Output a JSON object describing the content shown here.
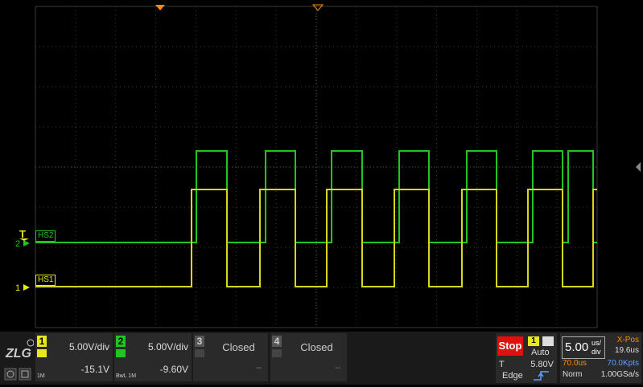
{
  "waveform": {
    "channel_markers": [
      "2",
      "1"
    ],
    "trigger_marker": "T",
    "labels": [
      "HS2",
      "HS1"
    ]
  },
  "channels": [
    {
      "number": "1",
      "scale": "5.00V/div",
      "offset": "-15.1V",
      "impedance": "1M",
      "color": "#e8e81e"
    },
    {
      "number": "2",
      "scale": "5.00V/div",
      "offset": "-9.60V",
      "impedance": "BwL 1M",
      "color": "#22c422"
    },
    {
      "number": "3",
      "status": "Closed",
      "placeholder": "--"
    },
    {
      "number": "4",
      "status": "Closed",
      "placeholder": "--"
    }
  ],
  "trigger": {
    "state": "Stop",
    "source": "1",
    "mode": "Auto",
    "label": "T",
    "level": "5.80V",
    "type": "Edge"
  },
  "timebase": {
    "scale": "5.00",
    "unit_top": "us/",
    "unit_bottom": "div",
    "xpos_label": "X-Pos",
    "xpos_value": "19.6us",
    "delay": "70.0us",
    "memory": "70.0Kpts",
    "acq_mode": "Norm",
    "sample_rate": "1.00GSa/s"
  },
  "colors": {
    "ch1": "#e8e81e",
    "ch2": "#22c422",
    "trigger_orange": "#ff8c00",
    "stop_red": "#e01010"
  }
}
